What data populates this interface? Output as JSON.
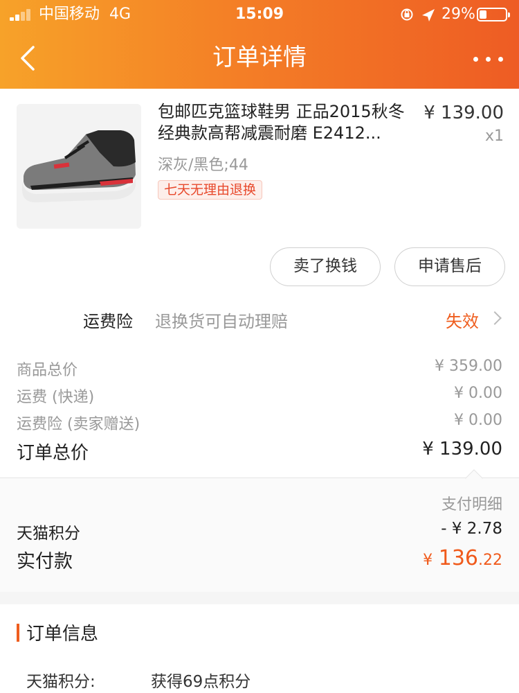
{
  "status_bar": {
    "carrier": "中国移动",
    "network": "4G",
    "time": "15:09",
    "battery_percent": "29%",
    "battery_level": 0.29,
    "signal_bars": 2
  },
  "header": {
    "title": "订单详情",
    "back_icon": "chevron-left-icon",
    "more_icon": "more-dots-icon"
  },
  "product": {
    "name": "包邮匹克篮球鞋男 正品2015秋冬经典款高帮减震耐磨 E2412...",
    "price": "¥ 139.00",
    "quantity": "x1",
    "spec": "深灰/黑色;44",
    "tag": "七天无理由退换"
  },
  "actions": {
    "sell_label": "卖了换钱",
    "after_sale_label": "申请售后"
  },
  "shipping_insurance": {
    "label": "运费险",
    "description": "退换货可自动理赔",
    "status": "失效"
  },
  "summary": {
    "goods_total_label": "商品总价",
    "goods_total_value": "¥ 359.00",
    "shipping_label": "运费 (快递)",
    "shipping_value": "¥ 0.00",
    "insurance_label": "运费险 (卖家赠送)",
    "insurance_value": "¥ 0.00",
    "order_total_label": "订单总价",
    "order_total_value": "¥ 139.00"
  },
  "payment": {
    "detail_link": "支付明细",
    "points_label": "天猫积分",
    "points_value": "- ¥ 2.78",
    "actual_label": "实付款",
    "actual_currency": "¥",
    "actual_int": "136",
    "actual_dec": ".22"
  },
  "order_info": {
    "title": "订单信息",
    "points_key": "天猫积分:",
    "points_value": "获得69点积分"
  },
  "colors": {
    "accent": "#ef5d1e",
    "header_start": "#f7a229",
    "header_end": "#ee5c24"
  }
}
